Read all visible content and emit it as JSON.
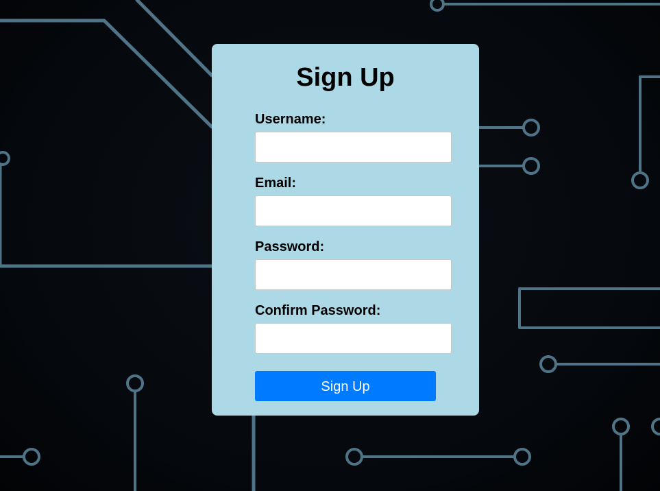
{
  "form": {
    "title": "Sign Up",
    "fields": [
      {
        "label": "Username:",
        "value": "",
        "placeholder": ""
      },
      {
        "label": "Email:",
        "value": "",
        "placeholder": ""
      },
      {
        "label": "Password:",
        "value": "",
        "placeholder": ""
      },
      {
        "label": "Confirm Password:",
        "value": "",
        "placeholder": ""
      }
    ],
    "submit_label": "Sign Up"
  },
  "colors": {
    "background": "#05080c",
    "circuit_lines": "#4f7488",
    "card": "#add8e6",
    "button": "#007bff",
    "button_text": "#ffffff",
    "text": "#000000"
  }
}
